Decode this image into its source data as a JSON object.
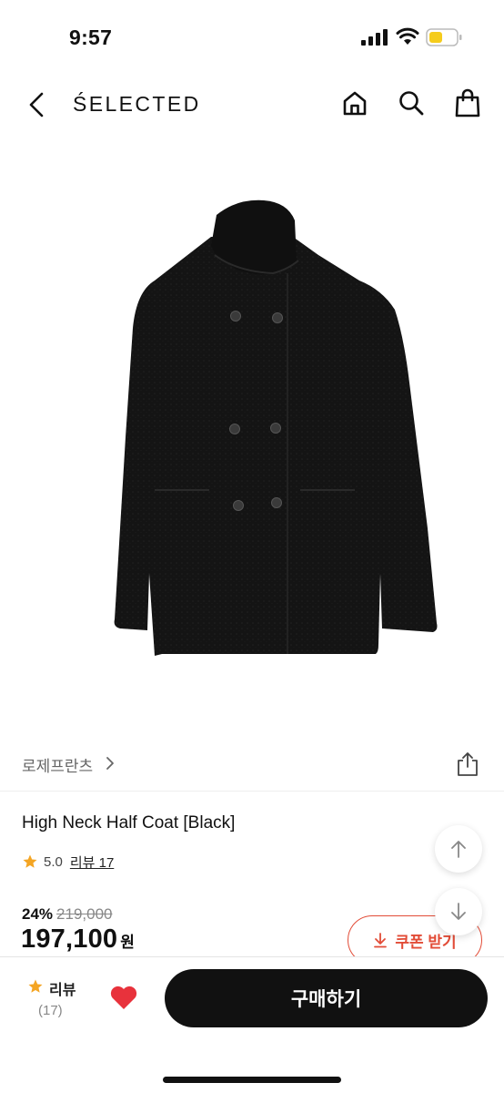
{
  "status_bar": {
    "time": "9:57"
  },
  "nav": {
    "brand": "ŚELECTED",
    "icons": [
      "chevron-left-icon",
      "home-icon",
      "search-icon",
      "shopping-bag-icon"
    ]
  },
  "product": {
    "image_alt": "black double-breasted high neck coat",
    "brand_link": "로제프란츠",
    "title": "High Neck Half Coat [Black]",
    "rating": "5.0",
    "review_link": "리뷰 17",
    "discount": "24%",
    "original_price": "219,000",
    "price": "197,100",
    "price_unit": "원",
    "coupon_label": "쿠폰 받기"
  },
  "bottom_bar": {
    "review_label": "리뷰",
    "review_count": "(17)",
    "buy_label": "구매하기"
  },
  "colors": {
    "accent_red": "#e24c37",
    "star": "#f4a523",
    "heart": "#e8323c",
    "buy_button": "#111111"
  }
}
